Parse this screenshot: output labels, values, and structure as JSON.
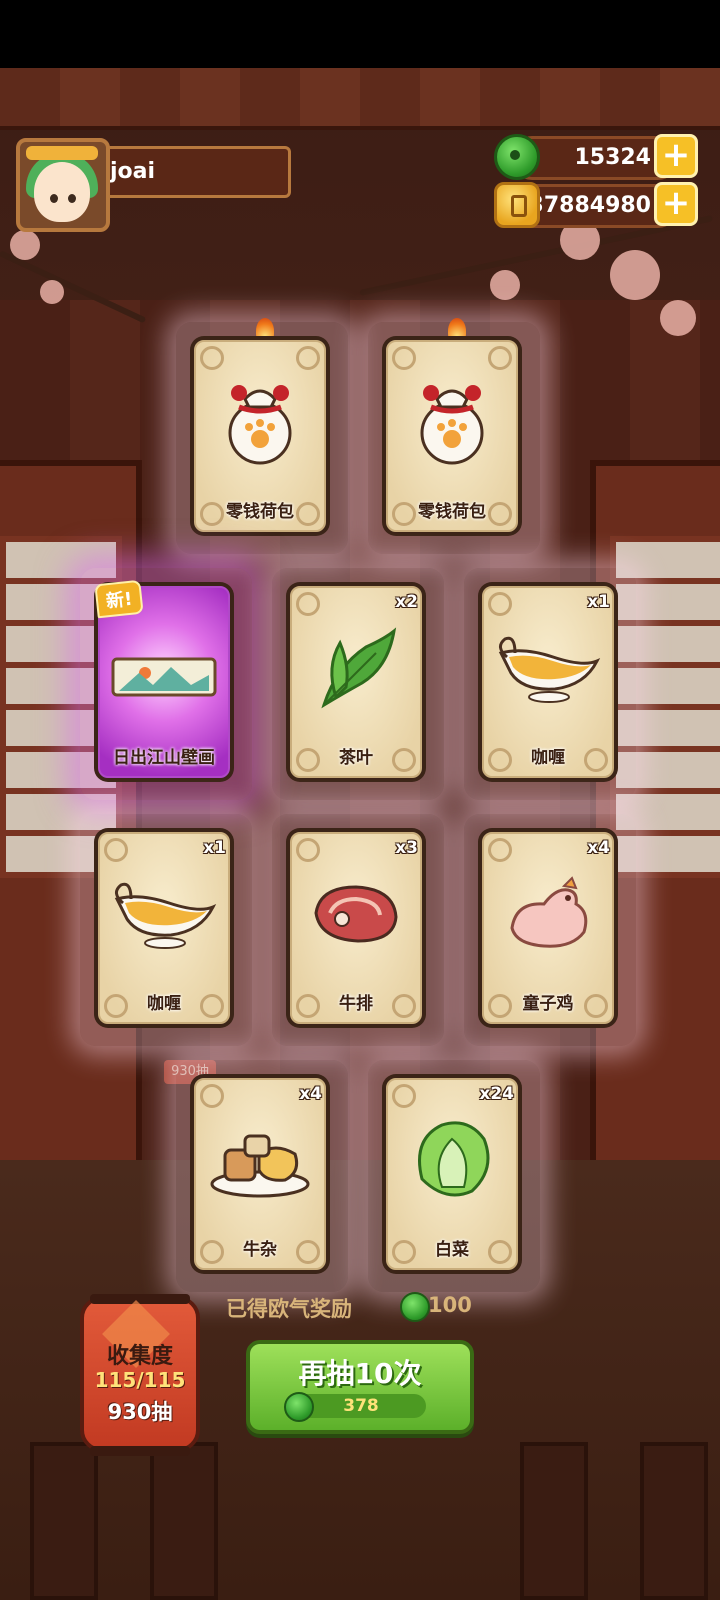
{
  "player": {
    "name": "joai"
  },
  "currency": {
    "jade": "15324",
    "coins": "37884980",
    "add_symbol": "+"
  },
  "cards": [
    {
      "name": "零钱荷包",
      "count": "",
      "hot": true
    },
    {
      "name": "零钱荷包",
      "count": "",
      "hot": true
    },
    {
      "name": "日出江山壁画",
      "count": "",
      "new": true,
      "new_label": "新!"
    },
    {
      "name": "茶叶",
      "count": "x2"
    },
    {
      "name": "咖喱",
      "count": "x1"
    },
    {
      "name": "咖喱",
      "count": "x1"
    },
    {
      "name": "牛排",
      "count": "x3"
    },
    {
      "name": "童子鸡",
      "count": "x4"
    },
    {
      "name": "牛杂",
      "count": "x4"
    },
    {
      "name": "白菜",
      "count": "x24"
    }
  ],
  "reward": {
    "label": "已得欧气奖励",
    "value": "100"
  },
  "redraw": {
    "label": "再抽10次",
    "cost": "378"
  },
  "collection": {
    "title": "收集度",
    "progress": "115/115",
    "draws": "930抽"
  },
  "background_tag": "930抽",
  "colors": {
    "accent_green": "#5cb02a",
    "gold": "#f6c026",
    "card_bg": "#f6e9c8",
    "new_purple": "#e070e8"
  }
}
